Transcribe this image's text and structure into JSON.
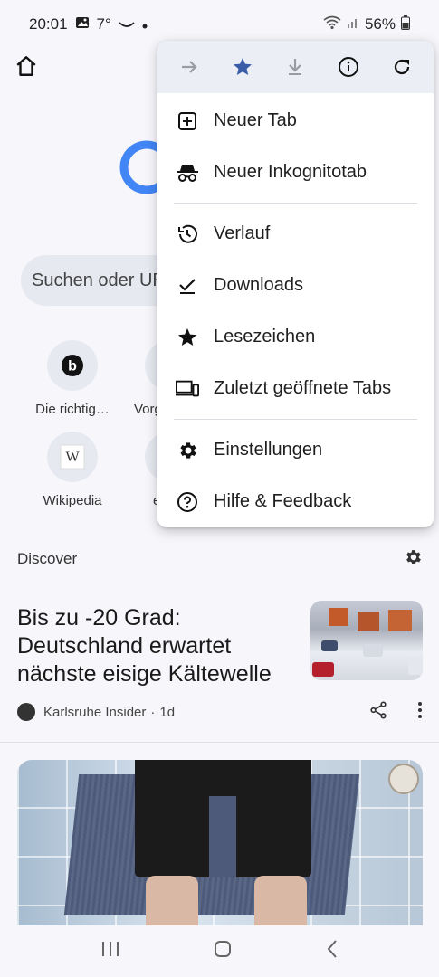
{
  "status_bar": {
    "time": "20:01",
    "temperature": "7°",
    "battery": "56%"
  },
  "search": {
    "placeholder_visible": "Suchen oder UR"
  },
  "shortcuts": [
    {
      "label": "Die richtig…",
      "icon": "bing-b-icon"
    },
    {
      "label": "Vorg",
      "icon": "partial"
    },
    {
      "label": "Wikipedia",
      "icon": "wikipedia-w-icon"
    },
    {
      "label": "e",
      "icon": "partial"
    }
  ],
  "discover": {
    "title": "Discover",
    "article": {
      "title": "Bis zu -20 Grad: Deutschland erwartet nächste eisige Kältewelle",
      "source": "Karlsruhe Insider",
      "age": "1d"
    }
  },
  "menu": {
    "toolbar": [
      "forward-arrow-icon",
      "bookmark-star-icon",
      "download-icon",
      "info-icon",
      "reload-icon"
    ],
    "items": [
      {
        "label": "Neuer Tab",
        "icon": "new-tab-icon"
      },
      {
        "label": "Neuer Inkognitotab",
        "icon": "incognito-icon"
      },
      {
        "label": "Verlauf",
        "icon": "history-icon"
      },
      {
        "label": "Downloads",
        "icon": "downloads-check-icon"
      },
      {
        "label": "Lesezeichen",
        "icon": "bookmarks-star-icon"
      },
      {
        "label": "Zuletzt geöffnete Tabs",
        "icon": "recent-tabs-icon"
      },
      {
        "label": "Einstellungen",
        "icon": "settings-gear-icon"
      },
      {
        "label": "Hilfe & Feedback",
        "icon": "help-icon"
      }
    ]
  },
  "colors": {
    "accent_blue": "#1a73e8",
    "bookmark_star": "#3a5ba6",
    "background": "#f7f7fb"
  }
}
